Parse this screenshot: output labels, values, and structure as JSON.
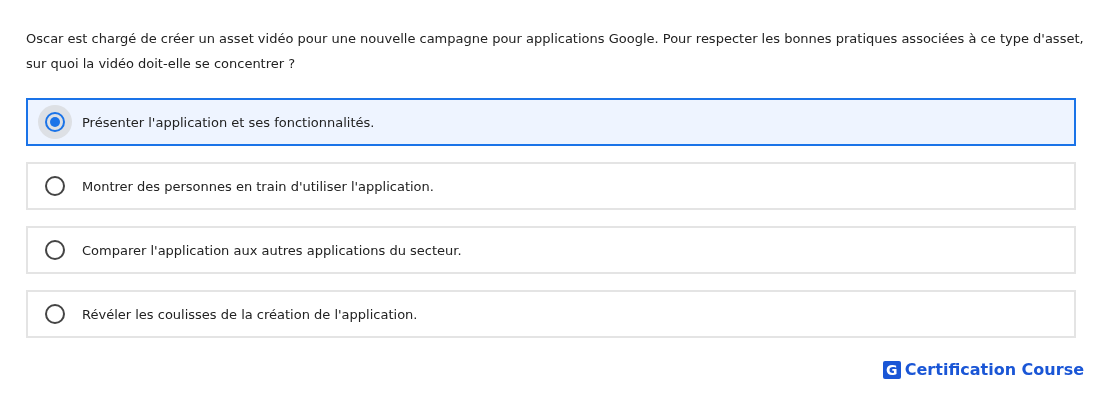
{
  "question": "Oscar est chargé de créer un asset vidéo pour une nouvelle campagne pour applications Google. Pour respecter les bonnes pratiques associées à ce type d'asset, sur quoi la vidéo doit-elle se concentrer ?",
  "options": [
    {
      "label": "Présenter l'application et ses fonctionnalités.",
      "selected": true
    },
    {
      "label": "Montrer des personnes en train d'utiliser l'application.",
      "selected": false
    },
    {
      "label": "Comparer l'application aux autres applications du secteur.",
      "selected": false
    },
    {
      "label": "Révéler les coulisses de la création de l'application.",
      "selected": false
    }
  ],
  "logo": {
    "mark": "G",
    "text": "Certification Course"
  }
}
